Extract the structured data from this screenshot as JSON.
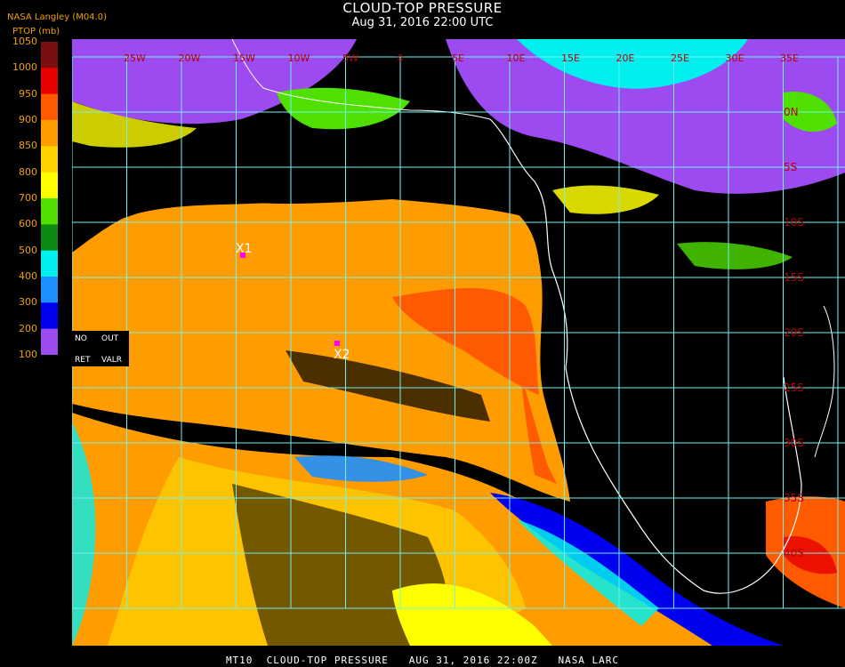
{
  "header": {
    "source": "NASA Langley (M04.0)",
    "title": "CLOUD-TOP PRESSURE",
    "subtitle": "Aug 31, 2016 22:00 UTC",
    "unit_label": "PTOP (mb)"
  },
  "legend": {
    "ticks": [
      "1050",
      "1000",
      "950",
      "900",
      "850",
      "800",
      "700",
      "600",
      "500",
      "400",
      "300",
      "200",
      "100"
    ],
    "bands": [
      {
        "label": "1000-1050",
        "color": "#7a0f10"
      },
      {
        "label": "950-1000",
        "color": "#e80000"
      },
      {
        "label": "900-950",
        "color": "#ff5a00"
      },
      {
        "label": "850-900",
        "color": "#ff9d00"
      },
      {
        "label": "800-850",
        "color": "#ffd200"
      },
      {
        "label": "700-800",
        "color": "#ffff00"
      },
      {
        "label": "600-700",
        "color": "#4fe000"
      },
      {
        "label": "500-600",
        "color": "#0d8a14"
      },
      {
        "label": "400-500",
        "color": "#00f0f0"
      },
      {
        "label": "300-400",
        "color": "#1e90ff"
      },
      {
        "label": "200-300",
        "color": "#0000f0"
      },
      {
        "label": "100-200",
        "color": "#9b4bf0"
      }
    ],
    "flags": {
      "no": "NO",
      "out": "OUT",
      "ret": "RET",
      "valr": "VALR"
    }
  },
  "map": {
    "grid_color": "#6ff2f2",
    "lon_labels_top": [
      "25W",
      "20W",
      "15W",
      "10W",
      "5W",
      "0",
      "5E",
      "10E",
      "15E",
      "20E",
      "25E",
      "30E",
      "35E"
    ],
    "lat_labels_right": [
      "0N",
      "5S",
      "10S",
      "15S",
      "20S",
      "25S",
      "30S",
      "35S",
      "40S"
    ],
    "markers": [
      {
        "label": "X1",
        "color": "#ff00ff"
      },
      {
        "label": "X2",
        "color": "#ff00ff"
      }
    ]
  },
  "footer": {
    "text": "MT10  CLOUD-TOP PRESSURE   AUG 31, 2016 22:00Z   NASA LARC"
  }
}
